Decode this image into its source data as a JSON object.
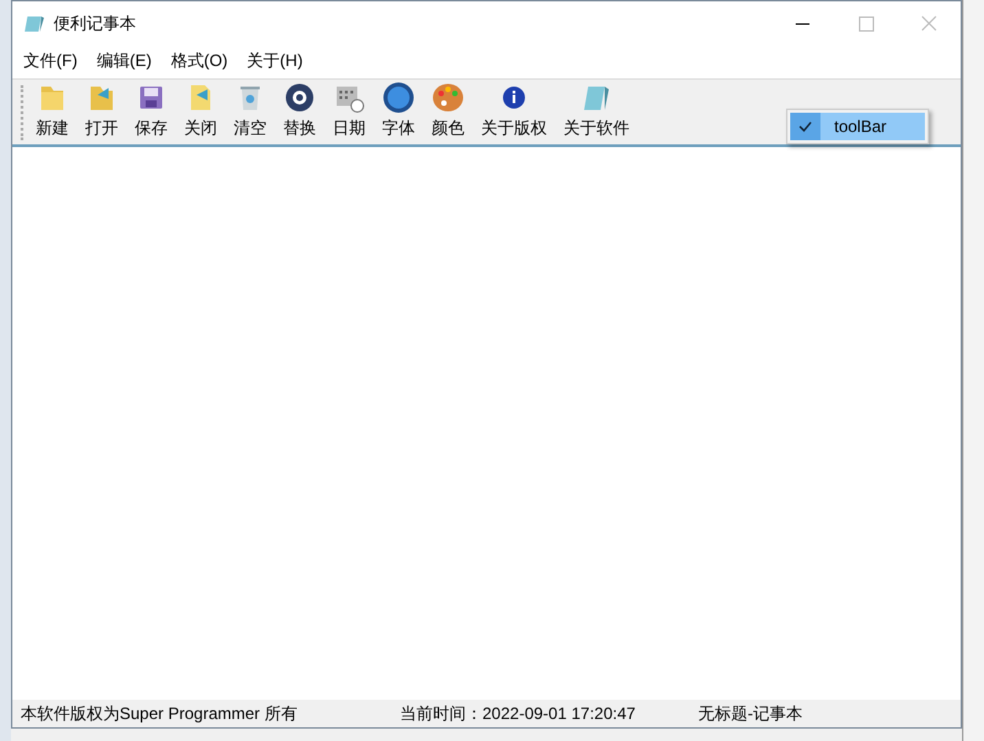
{
  "window": {
    "title": "便利记事本"
  },
  "menu": [
    "文件(F)",
    "编辑(E)",
    "格式(O)",
    "关于(H)"
  ],
  "toolbar": [
    {
      "label": "新建"
    },
    {
      "label": "打开"
    },
    {
      "label": "保存"
    },
    {
      "label": "关闭"
    },
    {
      "label": "清空"
    },
    {
      "label": "替换"
    },
    {
      "label": "日期"
    },
    {
      "label": "字体"
    },
    {
      "label": "颜色"
    },
    {
      "label": "关于版权"
    },
    {
      "label": "关于软件"
    }
  ],
  "context_menu": {
    "items": [
      {
        "label": "toolBar",
        "checked": true
      }
    ]
  },
  "status_bar": [
    "本软件版权为Super Programmer 所有",
    "当前时间：2022-09-01 17:20:47",
    "无标题-记事本"
  ]
}
